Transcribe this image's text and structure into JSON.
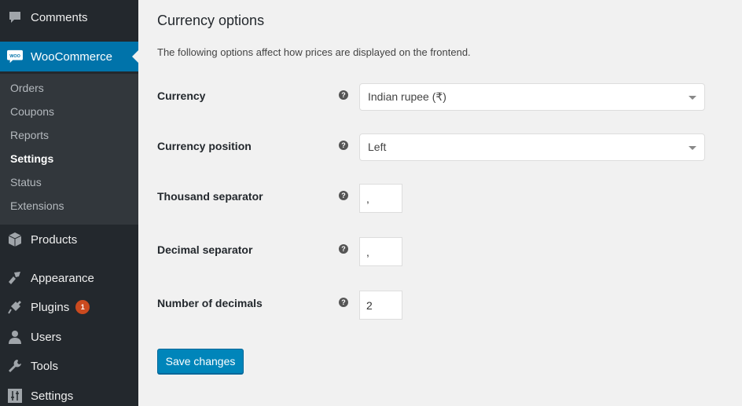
{
  "sidebar": {
    "items": [
      {
        "label": "Comments",
        "icon": "comment-icon"
      },
      {
        "label": "WooCommerce",
        "icon": "woo-icon",
        "current": true
      },
      {
        "label": "Products",
        "icon": "box-icon"
      },
      {
        "label": "Appearance",
        "icon": "paintbrush-icon"
      },
      {
        "label": "Plugins",
        "icon": "plug-icon",
        "badge": "1"
      },
      {
        "label": "Users",
        "icon": "user-icon"
      },
      {
        "label": "Tools",
        "icon": "wrench-icon"
      },
      {
        "label": "Settings",
        "icon": "sliders-icon"
      }
    ],
    "woo_logo_text": "Woo",
    "submenu": [
      "Orders",
      "Coupons",
      "Reports",
      "Settings",
      "Status",
      "Extensions"
    ],
    "submenu_active": "Settings"
  },
  "main": {
    "title": "Currency options",
    "description": "The following options affect how prices are displayed on the frontend.",
    "help_glyph": "?",
    "fields": {
      "currency": {
        "label": "Currency",
        "value": "Indian rupee (₹)"
      },
      "position": {
        "label": "Currency position",
        "value": "Left"
      },
      "thousand": {
        "label": "Thousand separator",
        "value": ","
      },
      "decimal": {
        "label": "Decimal separator",
        "value": ","
      },
      "decimals": {
        "label": "Number of decimals",
        "value": "2"
      }
    },
    "save_label": "Save changes"
  },
  "colors": {
    "accent": "#0073aa",
    "button": "#0085ba",
    "badge": "#ca4a1f",
    "sidebar": "#23282d"
  }
}
